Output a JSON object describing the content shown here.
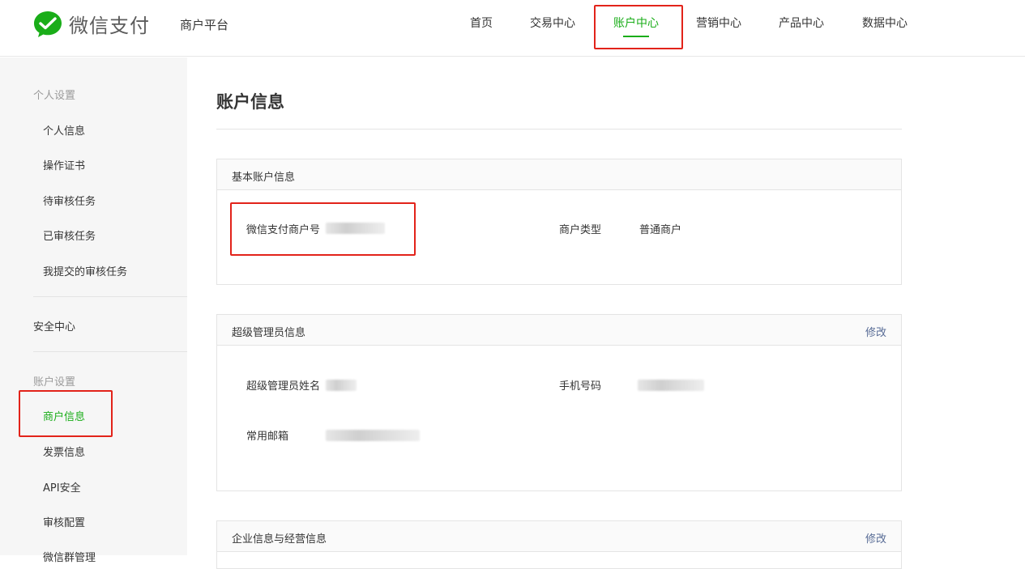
{
  "header": {
    "logo_text": "微信支付",
    "platform": "商户平台",
    "nav": [
      {
        "label": "首页"
      },
      {
        "label": "交易中心"
      },
      {
        "label": "账户中心",
        "active": true
      },
      {
        "label": "营销中心"
      },
      {
        "label": "产品中心"
      },
      {
        "label": "数据中心"
      }
    ]
  },
  "sidebar": {
    "personal_group": "个人设置",
    "personal_items": [
      "个人信息",
      "操作证书",
      "待审核任务",
      "已审核任务",
      "我提交的审核任务"
    ],
    "security": "安全中心",
    "account_group": "账户设置",
    "account_items": [
      "商户信息",
      "发票信息",
      "API安全",
      "审核配置",
      "微信群管理"
    ],
    "active_item": "商户信息"
  },
  "main": {
    "title": "账户信息",
    "basic": {
      "title": "基本账户信息",
      "merchant_id_label": "微信支付商户号",
      "merchant_type_label": "商户类型",
      "merchant_type_value": "普通商户"
    },
    "admin": {
      "title": "超级管理员信息",
      "edit": "修改",
      "name_label": "超级管理员姓名",
      "phone_label": "手机号码",
      "email_label": "常用邮箱"
    },
    "company": {
      "title": "企业信息与经营信息",
      "edit": "修改"
    }
  },
  "colors": {
    "accent": "#1aad19",
    "link": "#576b95",
    "highlight_border": "#e2231a"
  }
}
